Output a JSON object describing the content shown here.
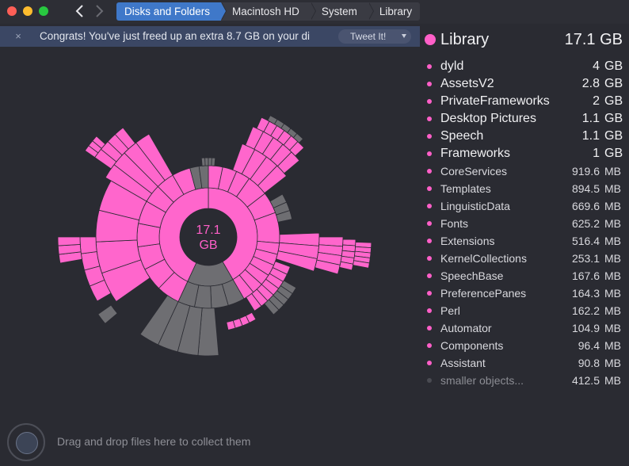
{
  "window": {
    "breadcrumb": [
      "Disks and Folders",
      "Macintosh HD",
      "System",
      "Library"
    ]
  },
  "banner": {
    "close_glyph": "×",
    "text": "Congrats! You've just freed up an extra 8.7 GB on your di",
    "tweet_label": "Tweet It!"
  },
  "chart": {
    "center_line1": "17.1",
    "center_line2": "GB"
  },
  "panel": {
    "header": {
      "name": "Library",
      "size": "17.1 GB"
    },
    "items": [
      {
        "name": "dyld",
        "value": "4",
        "unit": "GB"
      },
      {
        "name": "AssetsV2",
        "value": "2.8",
        "unit": "GB"
      },
      {
        "name": "PrivateFrameworks",
        "value": "2",
        "unit": "GB"
      },
      {
        "name": "Desktop Pictures",
        "value": "1.1",
        "unit": "GB"
      },
      {
        "name": "Speech",
        "value": "1.1",
        "unit": "GB"
      },
      {
        "name": "Frameworks",
        "value": "1",
        "unit": "GB"
      },
      {
        "name": "CoreServices",
        "value": "919.6",
        "unit": "MB"
      },
      {
        "name": "Templates",
        "value": "894.5",
        "unit": "MB"
      },
      {
        "name": "LinguisticData",
        "value": "669.6",
        "unit": "MB"
      },
      {
        "name": "Fonts",
        "value": "625.2",
        "unit": "MB"
      },
      {
        "name": "Extensions",
        "value": "516.4",
        "unit": "MB"
      },
      {
        "name": "KernelCollections",
        "value": "253.1",
        "unit": "MB"
      },
      {
        "name": "SpeechBase",
        "value": "167.6",
        "unit": "MB"
      },
      {
        "name": "PreferencePanes",
        "value": "164.3",
        "unit": "MB"
      },
      {
        "name": "Perl",
        "value": "162.2",
        "unit": "MB"
      },
      {
        "name": "Automator",
        "value": "104.9",
        "unit": "MB"
      },
      {
        "name": "Components",
        "value": "96.4",
        "unit": "MB"
      },
      {
        "name": "Assistant",
        "value": "90.8",
        "unit": "MB"
      },
      {
        "name": "smaller objects...",
        "value": "412.5",
        "unit": "MB"
      }
    ]
  },
  "footer": {
    "drop_text": "Drag and drop files here to collect them"
  },
  "colors": {
    "accent": "#ff5fc8",
    "selected_crumb": "#3f78c9",
    "grey_segment": "#6e6e72",
    "dark_segment": "#3b3c42"
  }
}
